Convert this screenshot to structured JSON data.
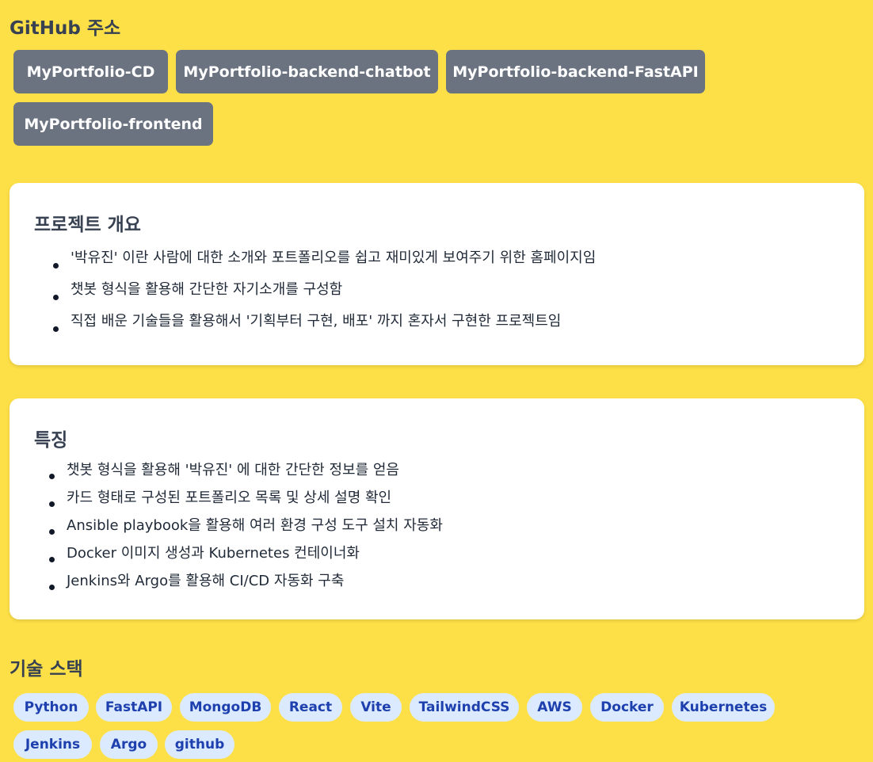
{
  "github": {
    "title": "GitHub 주소",
    "repos": [
      "MyPortfolio-CD",
      "MyPortfolio-backend-chatbot",
      "MyPortfolio-backend-FastAPI",
      "MyPortfolio-frontend"
    ]
  },
  "overview": {
    "title": "프로젝트 개요",
    "items": [
      "'박유진' 이란 사람에 대한 소개와 포트폴리오를 쉽고 재미있게 보여주기 위한 홈페이지임",
      "챗봇 형식을 활용해 간단한 자기소개를 구성함",
      "직접 배운 기술들을 활용해서 '기획부터 구현, 배포' 까지 혼자서 구현한 프로젝트임"
    ]
  },
  "features": {
    "title": "특징",
    "items": [
      "챗봇 형식을 활용해 '박유진' 에 대한 간단한 정보를 얻음",
      "카드 형태로 구성된 포트폴리오 목록 및 상세 설명 확인",
      "Ansible playbook을 활용해 여러 환경 구성 도구 설치 자동화",
      "Docker 이미지 생성과 Kubernetes 컨테이너화",
      "Jenkins와 Argo를 활용해 CI/CD 자동화 구축"
    ]
  },
  "stack": {
    "title": "기술 스택",
    "tags": [
      "Python",
      "FastAPI",
      "MongoDB",
      "React",
      "Vite",
      "TailwindCSS",
      "AWS",
      "Docker",
      "Kubernetes",
      "Jenkins",
      "Argo",
      "github"
    ]
  },
  "colors": {
    "background": "#FDE047",
    "button": "#6B7280",
    "tag_bg": "#DBEAFE",
    "tag_text": "#1E40AF"
  }
}
